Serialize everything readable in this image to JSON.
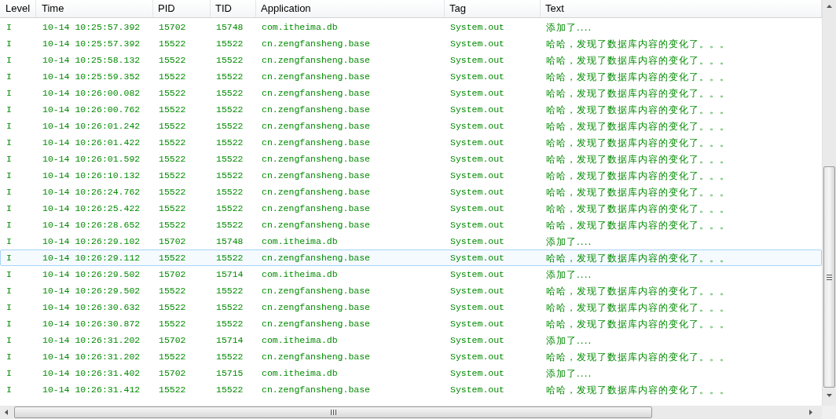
{
  "table": {
    "columns": [
      "Level",
      "Time",
      "PID",
      "TID",
      "Application",
      "Tag",
      "Text"
    ],
    "rows": [
      {
        "cells": [
          "I",
          "10-14 10:25:57.392",
          "15702",
          "15748",
          "com.itheima.db",
          "System.out",
          "添加了...."
        ],
        "selected": false
      },
      {
        "cells": [
          "I",
          "10-14 10:25:57.392",
          "15522",
          "15522",
          "cn.zengfansheng.base",
          "System.out",
          "哈哈，发现了数据库内容的变化了。。。"
        ],
        "selected": false
      },
      {
        "cells": [
          "I",
          "10-14 10:25:58.132",
          "15522",
          "15522",
          "cn.zengfansheng.base",
          "System.out",
          "哈哈，发现了数据库内容的变化了。。。"
        ],
        "selected": false
      },
      {
        "cells": [
          "I",
          "10-14 10:25:59.352",
          "15522",
          "15522",
          "cn.zengfansheng.base",
          "System.out",
          "哈哈，发现了数据库内容的变化了。。。"
        ],
        "selected": false
      },
      {
        "cells": [
          "I",
          "10-14 10:26:00.082",
          "15522",
          "15522",
          "cn.zengfansheng.base",
          "System.out",
          "哈哈，发现了数据库内容的变化了。。。"
        ],
        "selected": false
      },
      {
        "cells": [
          "I",
          "10-14 10:26:00.762",
          "15522",
          "15522",
          "cn.zengfansheng.base",
          "System.out",
          "哈哈，发现了数据库内容的变化了。。。"
        ],
        "selected": false
      },
      {
        "cells": [
          "I",
          "10-14 10:26:01.242",
          "15522",
          "15522",
          "cn.zengfansheng.base",
          "System.out",
          "哈哈，发现了数据库内容的变化了。。。"
        ],
        "selected": false
      },
      {
        "cells": [
          "I",
          "10-14 10:26:01.422",
          "15522",
          "15522",
          "cn.zengfansheng.base",
          "System.out",
          "哈哈，发现了数据库内容的变化了。。。"
        ],
        "selected": false
      },
      {
        "cells": [
          "I",
          "10-14 10:26:01.592",
          "15522",
          "15522",
          "cn.zengfansheng.base",
          "System.out",
          "哈哈，发现了数据库内容的变化了。。。"
        ],
        "selected": false
      },
      {
        "cells": [
          "I",
          "10-14 10:26:10.132",
          "15522",
          "15522",
          "cn.zengfansheng.base",
          "System.out",
          "哈哈，发现了数据库内容的变化了。。。"
        ],
        "selected": false
      },
      {
        "cells": [
          "I",
          "10-14 10:26:24.762",
          "15522",
          "15522",
          "cn.zengfansheng.base",
          "System.out",
          "哈哈，发现了数据库内容的变化了。。。"
        ],
        "selected": false
      },
      {
        "cells": [
          "I",
          "10-14 10:26:25.422",
          "15522",
          "15522",
          "cn.zengfansheng.base",
          "System.out",
          "哈哈，发现了数据库内容的变化了。。。"
        ],
        "selected": false
      },
      {
        "cells": [
          "I",
          "10-14 10:26:28.652",
          "15522",
          "15522",
          "cn.zengfansheng.base",
          "System.out",
          "哈哈，发现了数据库内容的变化了。。。"
        ],
        "selected": false
      },
      {
        "cells": [
          "I",
          "10-14 10:26:29.102",
          "15702",
          "15748",
          "com.itheima.db",
          "System.out",
          "添加了...."
        ],
        "selected": false
      },
      {
        "cells": [
          "I",
          "10-14 10:26:29.112",
          "15522",
          "15522",
          "cn.zengfansheng.base",
          "System.out",
          "哈哈，发现了数据库内容的变化了。。。"
        ],
        "selected": true
      },
      {
        "cells": [
          "I",
          "10-14 10:26:29.502",
          "15702",
          "15714",
          "com.itheima.db",
          "System.out",
          "添加了...."
        ],
        "selected": false
      },
      {
        "cells": [
          "I",
          "10-14 10:26:29.502",
          "15522",
          "15522",
          "cn.zengfansheng.base",
          "System.out",
          "哈哈，发现了数据库内容的变化了。。。"
        ],
        "selected": false
      },
      {
        "cells": [
          "I",
          "10-14 10:26:30.632",
          "15522",
          "15522",
          "cn.zengfansheng.base",
          "System.out",
          "哈哈，发现了数据库内容的变化了。。。"
        ],
        "selected": false
      },
      {
        "cells": [
          "I",
          "10-14 10:26:30.872",
          "15522",
          "15522",
          "cn.zengfansheng.base",
          "System.out",
          "哈哈，发现了数据库内容的变化了。。。"
        ],
        "selected": false
      },
      {
        "cells": [
          "I",
          "10-14 10:26:31.202",
          "15702",
          "15714",
          "com.itheima.db",
          "System.out",
          "添加了...."
        ],
        "selected": false
      },
      {
        "cells": [
          "I",
          "10-14 10:26:31.202",
          "15522",
          "15522",
          "cn.zengfansheng.base",
          "System.out",
          "哈哈，发现了数据库内容的变化了。。。"
        ],
        "selected": false
      },
      {
        "cells": [
          "I",
          "10-14 10:26:31.402",
          "15702",
          "15715",
          "com.itheima.db",
          "System.out",
          "添加了...."
        ],
        "selected": false
      },
      {
        "cells": [
          "I",
          "10-14 10:26:31.412",
          "15522",
          "15522",
          "cn.zengfansheng.base",
          "System.out",
          "哈哈，发现了数据库内容的变化了。。。"
        ],
        "selected": false
      }
    ]
  }
}
